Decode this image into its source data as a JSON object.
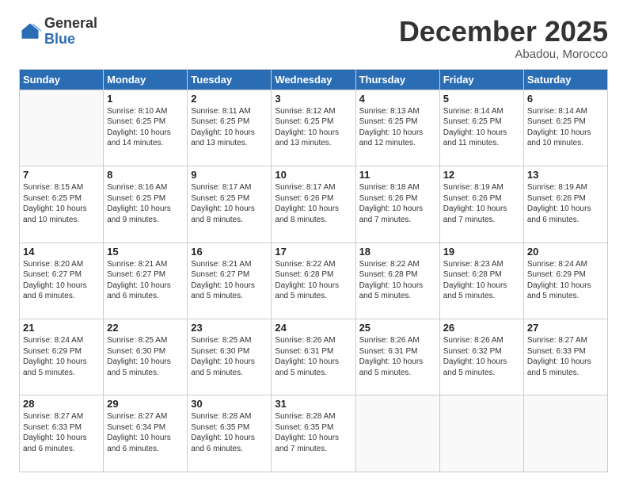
{
  "logo": {
    "general": "General",
    "blue": "Blue"
  },
  "header": {
    "month": "December 2025",
    "location": "Abadou, Morocco"
  },
  "weekdays": [
    "Sunday",
    "Monday",
    "Tuesday",
    "Wednesday",
    "Thursday",
    "Friday",
    "Saturday"
  ],
  "weeks": [
    [
      {
        "day": "",
        "content": ""
      },
      {
        "day": "1",
        "content": "Sunrise: 8:10 AM\nSunset: 6:25 PM\nDaylight: 10 hours\nand 14 minutes."
      },
      {
        "day": "2",
        "content": "Sunrise: 8:11 AM\nSunset: 6:25 PM\nDaylight: 10 hours\nand 13 minutes."
      },
      {
        "day": "3",
        "content": "Sunrise: 8:12 AM\nSunset: 6:25 PM\nDaylight: 10 hours\nand 13 minutes."
      },
      {
        "day": "4",
        "content": "Sunrise: 8:13 AM\nSunset: 6:25 PM\nDaylight: 10 hours\nand 12 minutes."
      },
      {
        "day": "5",
        "content": "Sunrise: 8:14 AM\nSunset: 6:25 PM\nDaylight: 10 hours\nand 11 minutes."
      },
      {
        "day": "6",
        "content": "Sunrise: 8:14 AM\nSunset: 6:25 PM\nDaylight: 10 hours\nand 10 minutes."
      }
    ],
    [
      {
        "day": "7",
        "content": "Sunrise: 8:15 AM\nSunset: 6:25 PM\nDaylight: 10 hours\nand 10 minutes."
      },
      {
        "day": "8",
        "content": "Sunrise: 8:16 AM\nSunset: 6:25 PM\nDaylight: 10 hours\nand 9 minutes."
      },
      {
        "day": "9",
        "content": "Sunrise: 8:17 AM\nSunset: 6:25 PM\nDaylight: 10 hours\nand 8 minutes."
      },
      {
        "day": "10",
        "content": "Sunrise: 8:17 AM\nSunset: 6:26 PM\nDaylight: 10 hours\nand 8 minutes."
      },
      {
        "day": "11",
        "content": "Sunrise: 8:18 AM\nSunset: 6:26 PM\nDaylight: 10 hours\nand 7 minutes."
      },
      {
        "day": "12",
        "content": "Sunrise: 8:19 AM\nSunset: 6:26 PM\nDaylight: 10 hours\nand 7 minutes."
      },
      {
        "day": "13",
        "content": "Sunrise: 8:19 AM\nSunset: 6:26 PM\nDaylight: 10 hours\nand 6 minutes."
      }
    ],
    [
      {
        "day": "14",
        "content": "Sunrise: 8:20 AM\nSunset: 6:27 PM\nDaylight: 10 hours\nand 6 minutes."
      },
      {
        "day": "15",
        "content": "Sunrise: 8:21 AM\nSunset: 6:27 PM\nDaylight: 10 hours\nand 6 minutes."
      },
      {
        "day": "16",
        "content": "Sunrise: 8:21 AM\nSunset: 6:27 PM\nDaylight: 10 hours\nand 5 minutes."
      },
      {
        "day": "17",
        "content": "Sunrise: 8:22 AM\nSunset: 6:28 PM\nDaylight: 10 hours\nand 5 minutes."
      },
      {
        "day": "18",
        "content": "Sunrise: 8:22 AM\nSunset: 6:28 PM\nDaylight: 10 hours\nand 5 minutes."
      },
      {
        "day": "19",
        "content": "Sunrise: 8:23 AM\nSunset: 6:28 PM\nDaylight: 10 hours\nand 5 minutes."
      },
      {
        "day": "20",
        "content": "Sunrise: 8:24 AM\nSunset: 6:29 PM\nDaylight: 10 hours\nand 5 minutes."
      }
    ],
    [
      {
        "day": "21",
        "content": "Sunrise: 8:24 AM\nSunset: 6:29 PM\nDaylight: 10 hours\nand 5 minutes."
      },
      {
        "day": "22",
        "content": "Sunrise: 8:25 AM\nSunset: 6:30 PM\nDaylight: 10 hours\nand 5 minutes."
      },
      {
        "day": "23",
        "content": "Sunrise: 8:25 AM\nSunset: 6:30 PM\nDaylight: 10 hours\nand 5 minutes."
      },
      {
        "day": "24",
        "content": "Sunrise: 8:26 AM\nSunset: 6:31 PM\nDaylight: 10 hours\nand 5 minutes."
      },
      {
        "day": "25",
        "content": "Sunrise: 8:26 AM\nSunset: 6:31 PM\nDaylight: 10 hours\nand 5 minutes."
      },
      {
        "day": "26",
        "content": "Sunrise: 8:26 AM\nSunset: 6:32 PM\nDaylight: 10 hours\nand 5 minutes."
      },
      {
        "day": "27",
        "content": "Sunrise: 8:27 AM\nSunset: 6:33 PM\nDaylight: 10 hours\nand 5 minutes."
      }
    ],
    [
      {
        "day": "28",
        "content": "Sunrise: 8:27 AM\nSunset: 6:33 PM\nDaylight: 10 hours\nand 6 minutes."
      },
      {
        "day": "29",
        "content": "Sunrise: 8:27 AM\nSunset: 6:34 PM\nDaylight: 10 hours\nand 6 minutes."
      },
      {
        "day": "30",
        "content": "Sunrise: 8:28 AM\nSunset: 6:35 PM\nDaylight: 10 hours\nand 6 minutes."
      },
      {
        "day": "31",
        "content": "Sunrise: 8:28 AM\nSunset: 6:35 PM\nDaylight: 10 hours\nand 7 minutes."
      },
      {
        "day": "",
        "content": ""
      },
      {
        "day": "",
        "content": ""
      },
      {
        "day": "",
        "content": ""
      }
    ]
  ]
}
